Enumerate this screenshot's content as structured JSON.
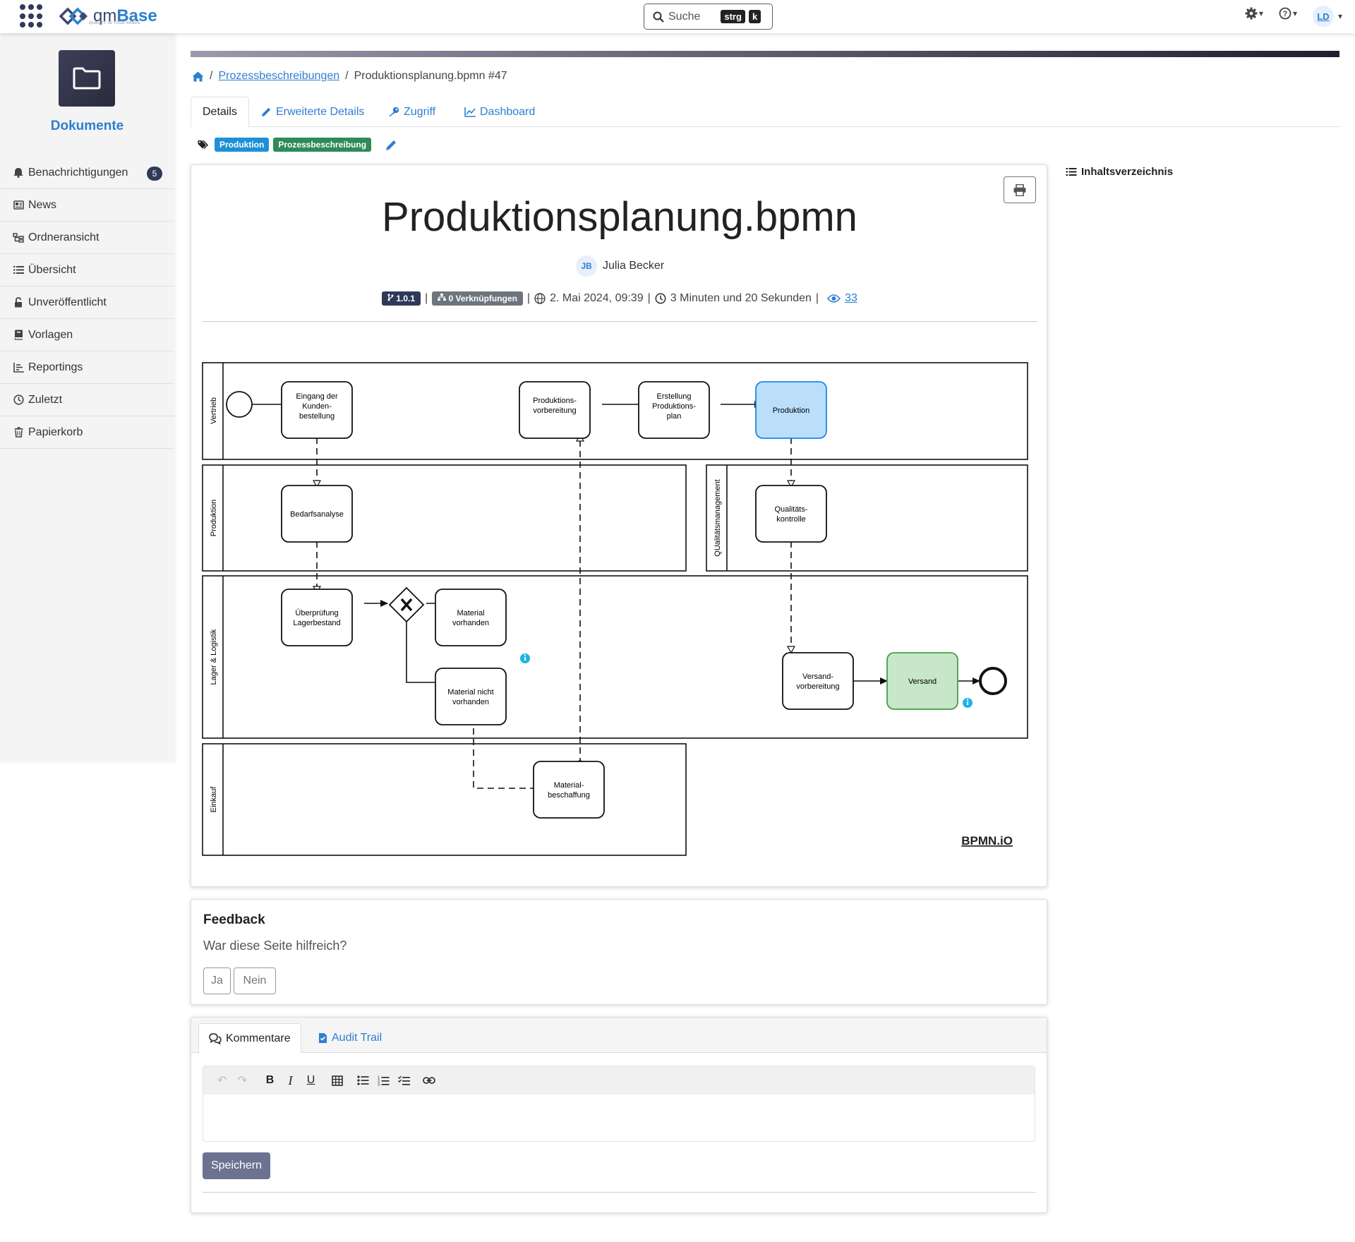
{
  "header": {
    "brand_prefix": "qm",
    "brand_name": "Base",
    "brand_tagline": "QUALITY IN YOUR HANDS",
    "search_label": "Suche",
    "shortcut_1": "strg",
    "shortcut_2": "k",
    "user_initials": "LD"
  },
  "sidebar": {
    "title": "Dokumente",
    "items": [
      {
        "label": "Benachrichtigungen",
        "icon": "bell-icon",
        "count": "5"
      },
      {
        "label": "News",
        "icon": "newspaper-icon"
      },
      {
        "label": "Ordneransicht",
        "icon": "folder-tree-icon"
      },
      {
        "label": "Übersicht",
        "icon": "list-icon"
      },
      {
        "label": "Unveröffentlicht",
        "icon": "lock-open-icon"
      },
      {
        "label": "Vorlagen",
        "icon": "book-icon"
      },
      {
        "label": "Reportings",
        "icon": "chart-icon"
      },
      {
        "label": "Zuletzt",
        "icon": "clock-icon"
      },
      {
        "label": "Papierkorb",
        "icon": "trash-icon"
      }
    ]
  },
  "breadcrumb": {
    "link": "Prozessbeschreibungen",
    "current": "Produktionsplanung.bpmn #47"
  },
  "tabs": [
    "Details",
    "Erweiterte Details",
    "Zugriff",
    "Dashboard"
  ],
  "tags": [
    {
      "label": "Produktion",
      "color": "#1e90d6"
    },
    {
      "label": "Prozessbeschreibung",
      "color": "#2e8b57"
    }
  ],
  "document": {
    "title": "Produktionsplanung.bpmn",
    "author_initials": "JB",
    "author": "Julia Becker",
    "version": "1.0.1",
    "links": "0 Verknüpfungen",
    "published": "2. Mai 2024, 09:39",
    "reading_time": "3 Minuten und 20 Sekunden",
    "views": "33"
  },
  "toc_label": "Inhaltsverzeichnis",
  "diagram": {
    "lanes": [
      "Vertrieb",
      "Produktion",
      "QUalitätsmanagement",
      "Lager & Logistik",
      "Einkauf"
    ],
    "tasks": {
      "eingang": [
        "Eingang der",
        "Kunden-",
        "bestellung"
      ],
      "prodvor": [
        "Produktions-",
        "vorbereitung"
      ],
      "erstellung": [
        "Erstellung",
        "Produktions-",
        "plan"
      ],
      "produktion": [
        "Produktion"
      ],
      "bedarf": [
        "Bedarfsanalyse"
      ],
      "qualitaet": [
        "Qualitäts-",
        "kontrolle"
      ],
      "ueberpruefung": [
        "Überprüfung",
        "Lagerbestand"
      ],
      "vorhanden": [
        "Material",
        "vorhanden"
      ],
      "nicht": [
        "Material nicht",
        "vorhanden"
      ],
      "versandvor": [
        "Versand-",
        "vorbereitung"
      ],
      "versand": [
        "Versand"
      ],
      "beschaffung": [
        "Material-",
        "beschaffung"
      ]
    },
    "watermark": "BPMN.iO",
    "colors": {
      "produktion_fill": "#bbdefb",
      "produktion_stroke": "#1e88e5",
      "versand_fill": "#c8e6c9",
      "versand_stroke": "#43a047",
      "info": "#1eb4e6"
    }
  },
  "feedback": {
    "title": "Feedback",
    "question": "War diese Seite hilfreich?",
    "yes": "Ja",
    "no": "Nein"
  },
  "comments": {
    "tab_comments": "Kommentare",
    "tab_audit": "Audit Trail",
    "save": "Speichern"
  }
}
